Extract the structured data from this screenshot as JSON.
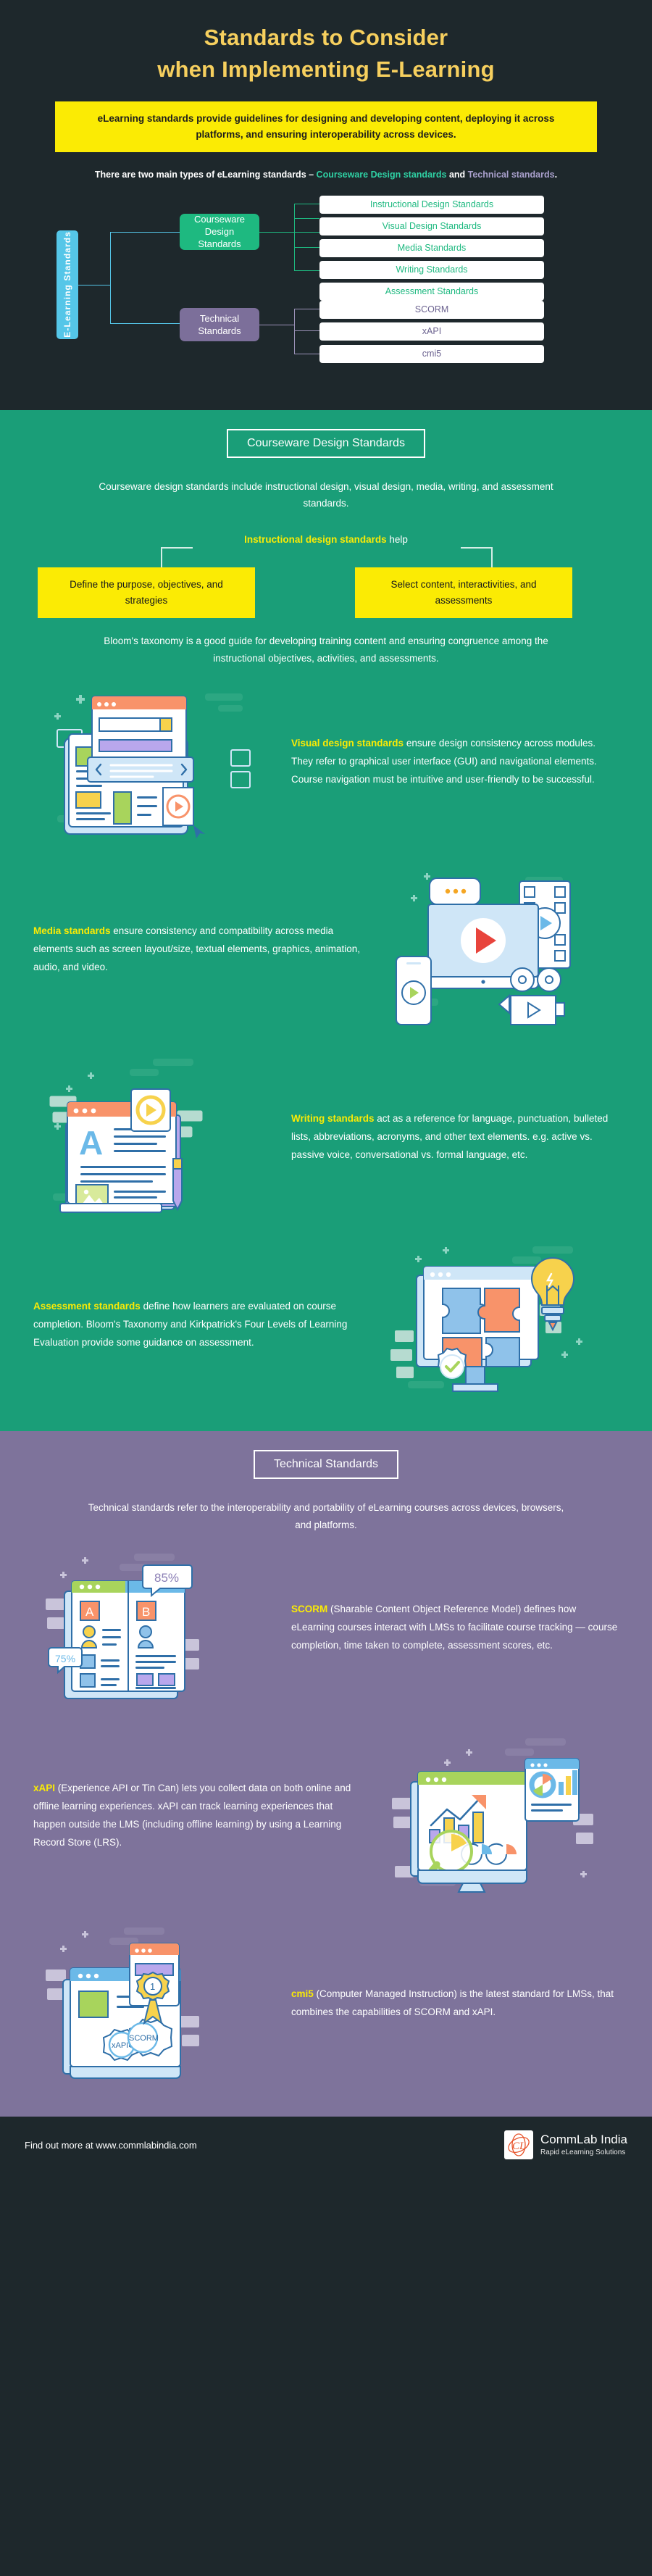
{
  "hero": {
    "title_line1": "Standards to Consider",
    "title_line2": "when Implementing E-Learning",
    "banner": "eLearning standards provide guidelines for designing and developing content, deploying it across platforms, and ensuring interoperability across devices.",
    "types_prefix": "There are two main types of eLearning standards – ",
    "types_courseware": "Courseware Design standards",
    "types_and": " and ",
    "types_technical": "Technical standards",
    "types_end": "."
  },
  "tree": {
    "root": "E-Learning Standards",
    "courseware_branch": "Courseware\nDesign Standards",
    "courseware_branch_l1": "Courseware",
    "courseware_branch_l2": "Design Standards",
    "technical_branch": "Technical Standards",
    "courseware_leaves": [
      "Instructional Design Standards",
      "Visual Design Standards",
      "Media Standards",
      "Writing Standards",
      "Assessment Standards"
    ],
    "technical_leaves": [
      "SCORM",
      "xAPI",
      "cmi5"
    ]
  },
  "courseware_section": {
    "title": "Courseware Design Standards",
    "intro": "Courseware design standards include instructional design, visual design, media, writing, and assessment standards.",
    "ids_label_bold": "Instructional design standards",
    "ids_label_rest": " help",
    "card_left": "Define the purpose, objectives, and strategies",
    "card_right": "Select content, interactivities, and assessments",
    "bloom": "Bloom's taxonomy is a good guide for developing training content and ensuring congruence among the instructional objectives, activities, and assessments.",
    "features": [
      {
        "id": "visual-design",
        "bold": "Visual design standards",
        "text": " ensure design consistency across modules. They refer to graphical user interface (GUI) and navigational elements. Course navigation must be intuitive and user-friendly to be successful.",
        "art": "browser-slides-illustration"
      },
      {
        "id": "media",
        "bold": "Media standards",
        "text": " ensure consistency and compatibility across media elements such as screen layout/size, textual elements, graphics, animation, audio, and video.",
        "art": "media-devices-illustration"
      },
      {
        "id": "writing",
        "bold": "Writing standards",
        "text": " act as a reference for language, punctuation, bulleted lists, abbreviations, acronyms, and other text elements. e.g. active vs. passive voice, conversational vs. formal language, etc.",
        "art": "document-typography-illustration"
      },
      {
        "id": "assessment",
        "bold": "Assessment standards",
        "text": " define how learners are evaluated on course completion. Bloom's Taxonomy and Kirkpatrick's Four Levels of Learning Evaluation provide some guidance on assessment.",
        "art": "puzzle-lightbulb-illustration"
      }
    ]
  },
  "technical_section": {
    "title": "Technical Standards",
    "intro": "Technical standards refer to the interoperability and portability of eLearning courses across devices, browsers, and platforms.",
    "features": [
      {
        "id": "scorm",
        "bold": "SCORM",
        "text": " (Sharable Content Object Reference Model) defines how eLearning courses interact with LMSs to facilitate course tracking — course completion, time taken to complete, assessment scores, etc.",
        "art": "report-cards-illustration",
        "badge_top": "85%",
        "badge_side": "75%",
        "card_a": "A",
        "card_b": "B"
      },
      {
        "id": "xapi",
        "bold": "xAPI",
        "text": " (Experience API or Tin Can) lets you collect data on both online and offline learning experiences. xAPI can track learning experiences that happen outside the LMS (including offline learning) by using a Learning Record Store (LRS).",
        "art": "analytics-dashboard-illustration"
      },
      {
        "id": "cmi5",
        "bold": "cmi5",
        "text": " (Computer Managed Instruction) is the latest standard for LMSs, that combines the capabilities of SCORM and xAPI.",
        "art": "gears-badge-illustration",
        "gear_left": "xAPI",
        "gear_right": "SCORM",
        "medal": "1"
      }
    ]
  },
  "footer": {
    "url_text": "Find out more at www.commlabindia.com",
    "brand_mark": "CL",
    "brand_name": "CommLab India",
    "brand_tagline": "Rapid eLearning Solutions"
  },
  "colors": {
    "dark": "#1e282c",
    "yellow": "#fbeb04",
    "title_yellow": "#f6cf5e",
    "green": "#1a9e78",
    "teal_accent": "#1eb980",
    "cyan": "#55c6e8",
    "purple": "#7e739b",
    "purple_branch": "#7c6f9a"
  }
}
